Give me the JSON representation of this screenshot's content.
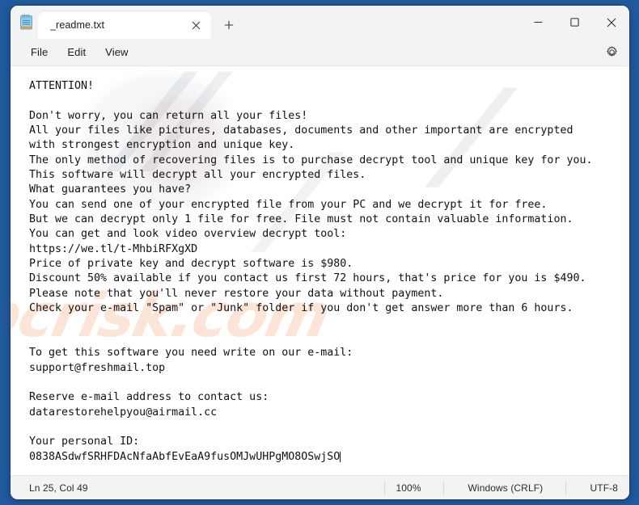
{
  "window": {
    "app_icon": "notepad-icon",
    "minimize_label": "Minimize",
    "maximize_label": "Maximize",
    "close_label": "Close"
  },
  "tabs": [
    {
      "title": "_readme.txt",
      "close_label": "Close tab",
      "active": true
    }
  ],
  "new_tab_label": "New tab",
  "menubar": {
    "items": [
      {
        "label": "File"
      },
      {
        "label": "Edit"
      },
      {
        "label": "View"
      }
    ],
    "settings_label": "Settings"
  },
  "editor": {
    "content": "ATTENTION!\n\nDon't worry, you can return all your files!\nAll your files like pictures, databases, documents and other important are encrypted\nwith strongest encryption and unique key.\nThe only method of recovering files is to purchase decrypt tool and unique key for you.\nThis software will decrypt all your encrypted files.\nWhat guarantees you have?\nYou can send one of your encrypted file from your PC and we decrypt it for free.\nBut we can decrypt only 1 file for free. File must not contain valuable information.\nYou can get and look video overview decrypt tool:\nhttps://we.tl/t-MhbiRFXgXD\nPrice of private key and decrypt software is $980.\nDiscount 50% available if you contact us first 72 hours, that's price for you is $490.\nPlease note that you'll never restore your data without payment.\nCheck your e-mail \"Spam\" or \"Junk\" folder if you don't get answer more than 6 hours.\n\n\nTo get this software you need write on our e-mail:\nsupport@freshmail.top\n\nReserve e-mail address to contact us:\ndatarestorehelpyou@airmail.cc\n\nYour personal ID:\n0838ASdwfSRHFDAcNfaAbfEvEaA9fusOMJwUHPgMO8OSwjSO",
    "watermark_text": "pcrisk.com",
    "watermark_fragment": ".com"
  },
  "statusbar": {
    "position": "Ln 25, Col 49",
    "zoom": "100%",
    "line_endings": "Windows (CRLF)",
    "encoding": "UTF-8"
  },
  "colors": {
    "desktop": "#215a9e",
    "window_chrome": "#f3f3f3",
    "tab_active": "#ffffff",
    "editor_bg": "#ffffff",
    "text": "#111111",
    "watermark_accent": "#f4aa78"
  }
}
